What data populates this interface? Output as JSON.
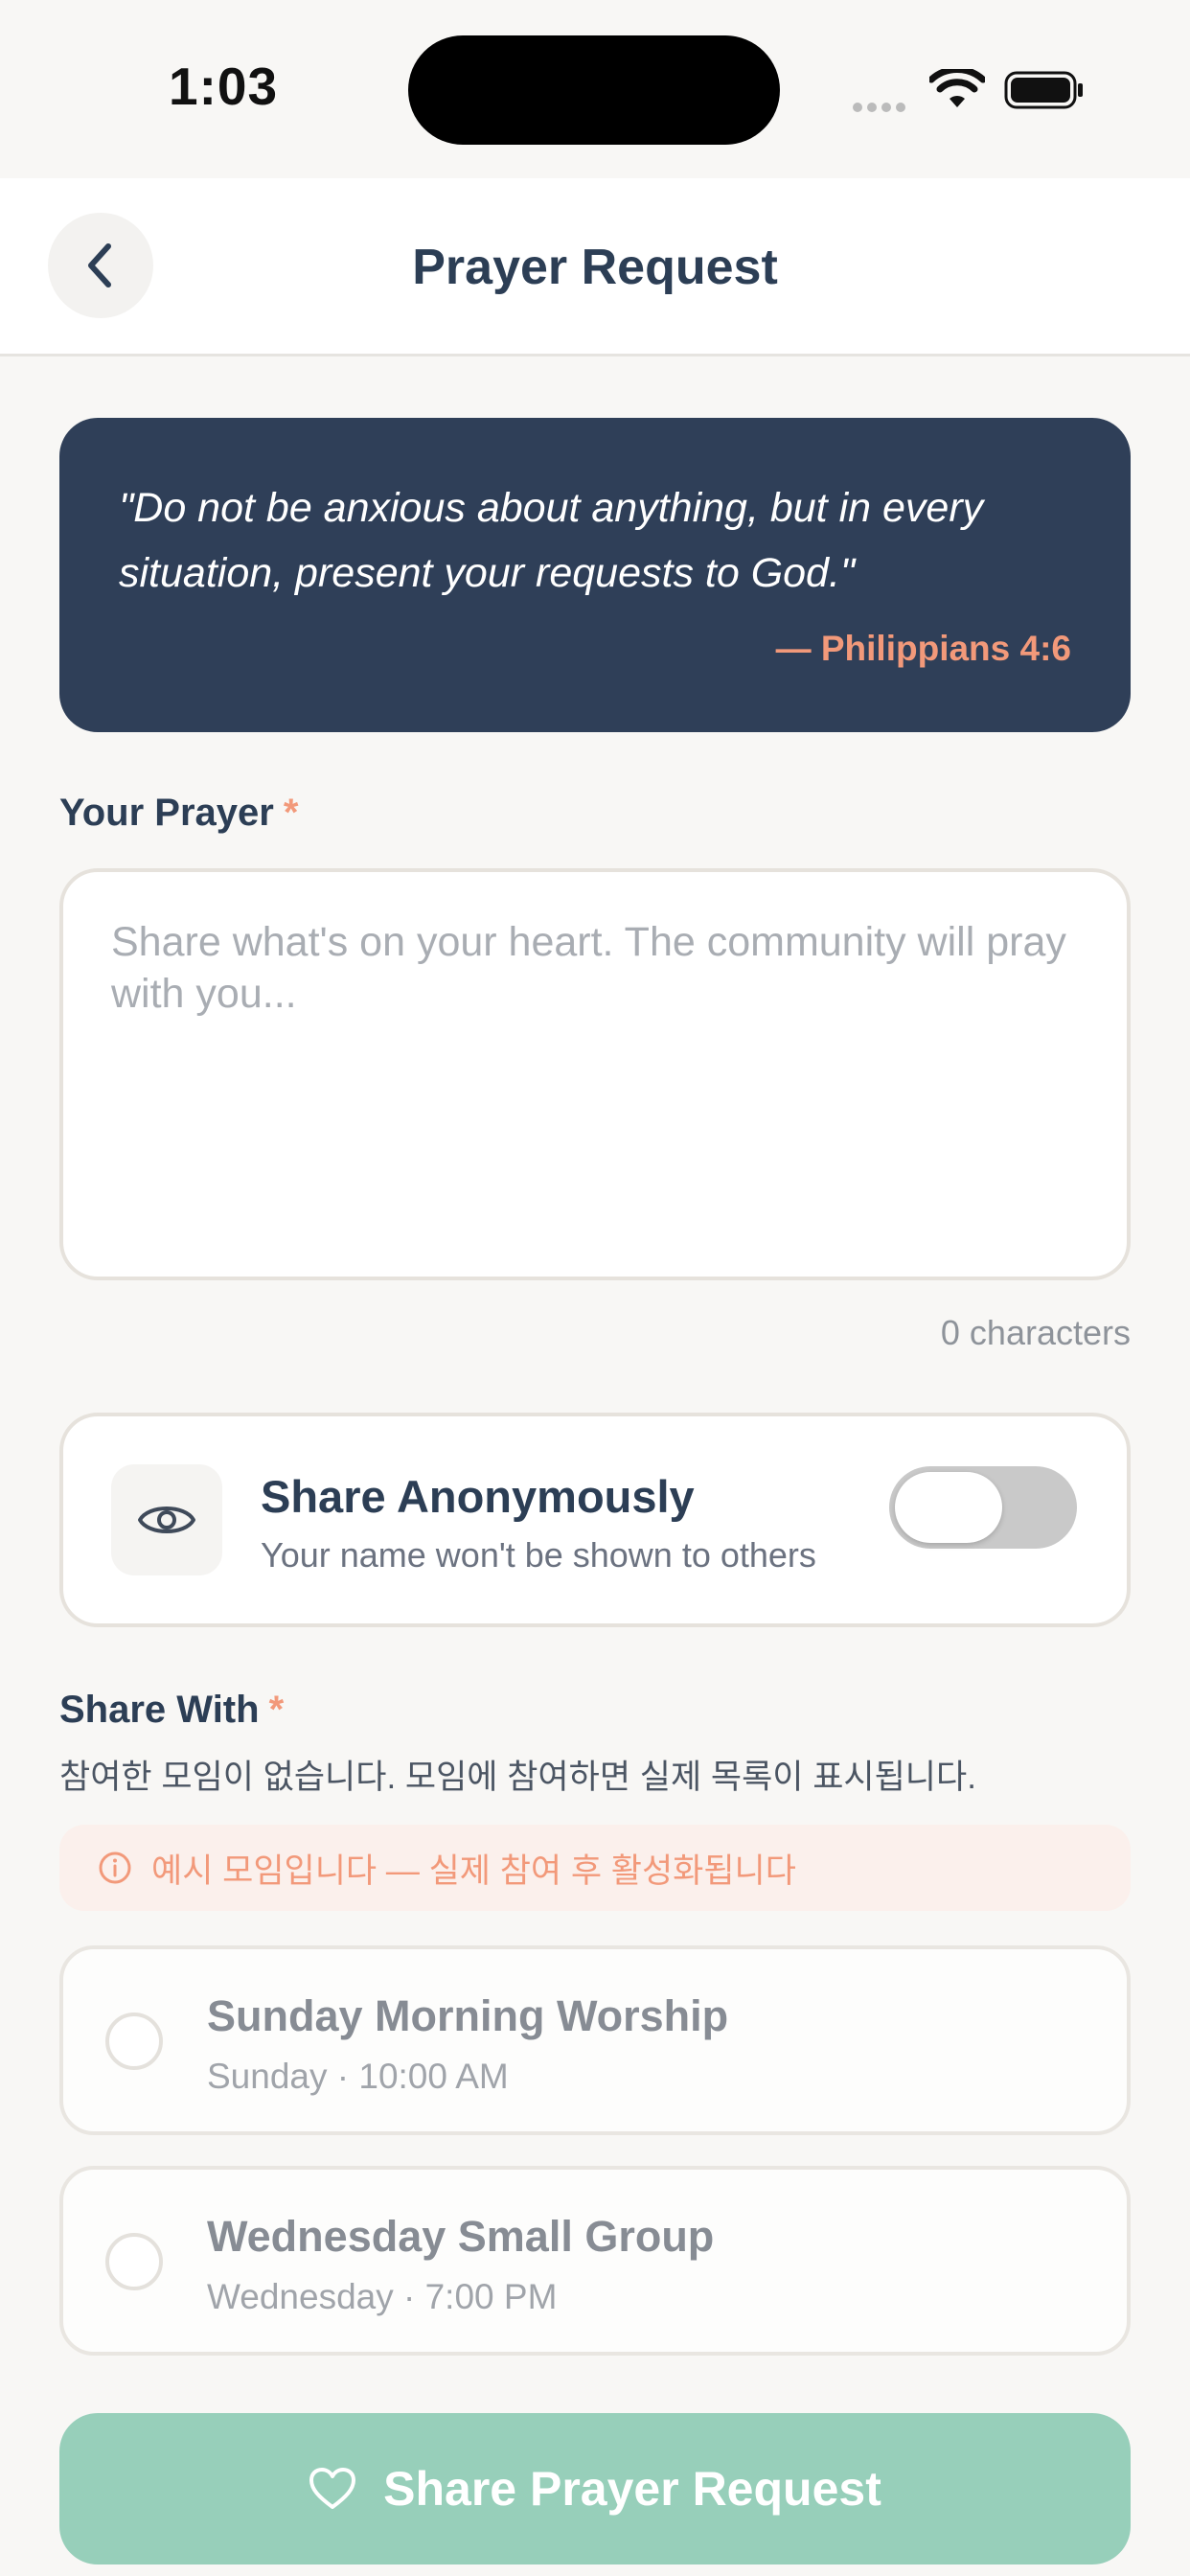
{
  "status_bar": {
    "time": "1:03"
  },
  "header": {
    "title": "Prayer Request",
    "back_icon": "chevron-left-icon"
  },
  "verse": {
    "text": "\"Do not be anxious about anything, but in every situation, present your requests to God.\"",
    "reference": "— Philippians 4:6"
  },
  "prayer": {
    "label": "Your Prayer",
    "required_marker": "*",
    "placeholder": "Share what's on your heart. The community will pray with you...",
    "value": "",
    "char_count": "0 characters"
  },
  "anonymous": {
    "icon": "eye-icon",
    "title": "Share Anonymously",
    "subtitle": "Your name won't be shown to others",
    "enabled": false
  },
  "share_with": {
    "label": "Share With",
    "required_marker": "*",
    "hint": "참여한 모임이 없습니다. 모임에 참여하면 실제 목록이 표시됩니다.",
    "notice_icon": "info-icon",
    "notice": "예시 모임입니다 — 실제 참여 후 활성화됩니다",
    "groups": [
      {
        "name": "Sunday Morning Worship",
        "schedule": "Sunday · 10:00 AM"
      },
      {
        "name": "Wednesday Small Group",
        "schedule": "Wednesday · 7:00 PM"
      }
    ]
  },
  "submit": {
    "icon": "heart-icon",
    "label": "Share Prayer Request"
  },
  "colors": {
    "primary_dark": "#2F3F58",
    "accent": "#F2997A",
    "submit_bg": "#97CFBA",
    "background": "#F8F7F5"
  }
}
